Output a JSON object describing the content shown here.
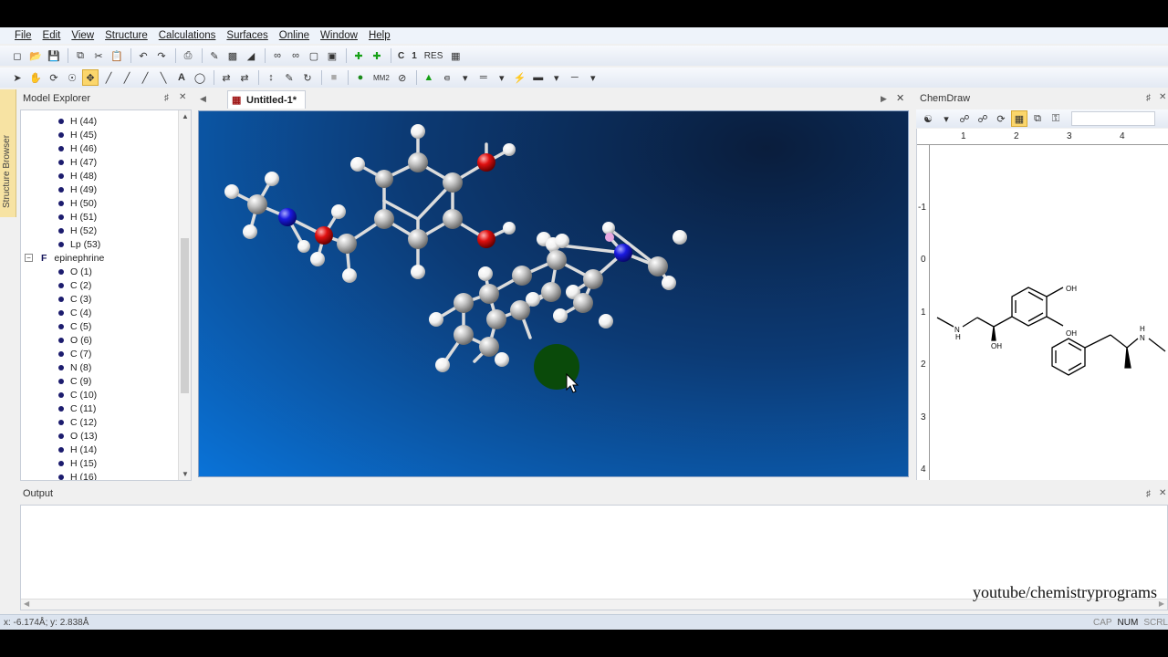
{
  "menu": [
    "File",
    "Edit",
    "View",
    "Structure",
    "Calculations",
    "Surfaces",
    "Online",
    "Window",
    "Help"
  ],
  "panels": {
    "left_tab": "Structure Browser",
    "model_explorer": "Model Explorer",
    "chemdraw": "ChemDraw",
    "output": "Output"
  },
  "document": {
    "tab_title": "Untitled-1*"
  },
  "tree": {
    "atoms_top": [
      "H (44)",
      "H (45)",
      "H (46)",
      "H (47)",
      "H (48)",
      "H (49)",
      "H (50)",
      "H (51)",
      "H (52)",
      "Lp (53)"
    ],
    "group_badge": "F",
    "group_name": "epinephrine",
    "atoms_group": [
      "O (1)",
      "C (2)",
      "C (3)",
      "C (4)",
      "C (5)",
      "O (6)",
      "C (7)",
      "N (8)",
      "C (9)",
      "C (10)",
      "C (11)",
      "C (12)",
      "O (13)",
      "H (14)",
      "H (15)",
      "H (16)"
    ]
  },
  "toolbar": {
    "bold_c": "C",
    "bold_1": "1",
    "res": "RES",
    "mm2": "MM2"
  },
  "chemdraw": {
    "ruler_x": [
      "1",
      "2",
      "3",
      "4"
    ],
    "ruler_y": [
      "-1",
      "0",
      "1",
      "2",
      "3",
      "4"
    ],
    "labels": {
      "oh1": "OH",
      "oh2": "OH",
      "oh3": "OH",
      "nh1": "H",
      "n1": "N",
      "nh2": "H",
      "n2": "N"
    }
  },
  "watermark": "youtube/chemistryprograms",
  "status": {
    "coord": "x: -6.174Å; y: 2.838Å",
    "indicators": [
      "CAP",
      "NUM",
      "SCRL"
    ],
    "active": "NUM"
  },
  "colors": {
    "carbon": "#b8b8b8",
    "hydrogen": "#f2f2f2",
    "oxygen": "#e01010",
    "nitrogen": "#1a1ae0",
    "lone_pair": "#0a4a0a"
  }
}
